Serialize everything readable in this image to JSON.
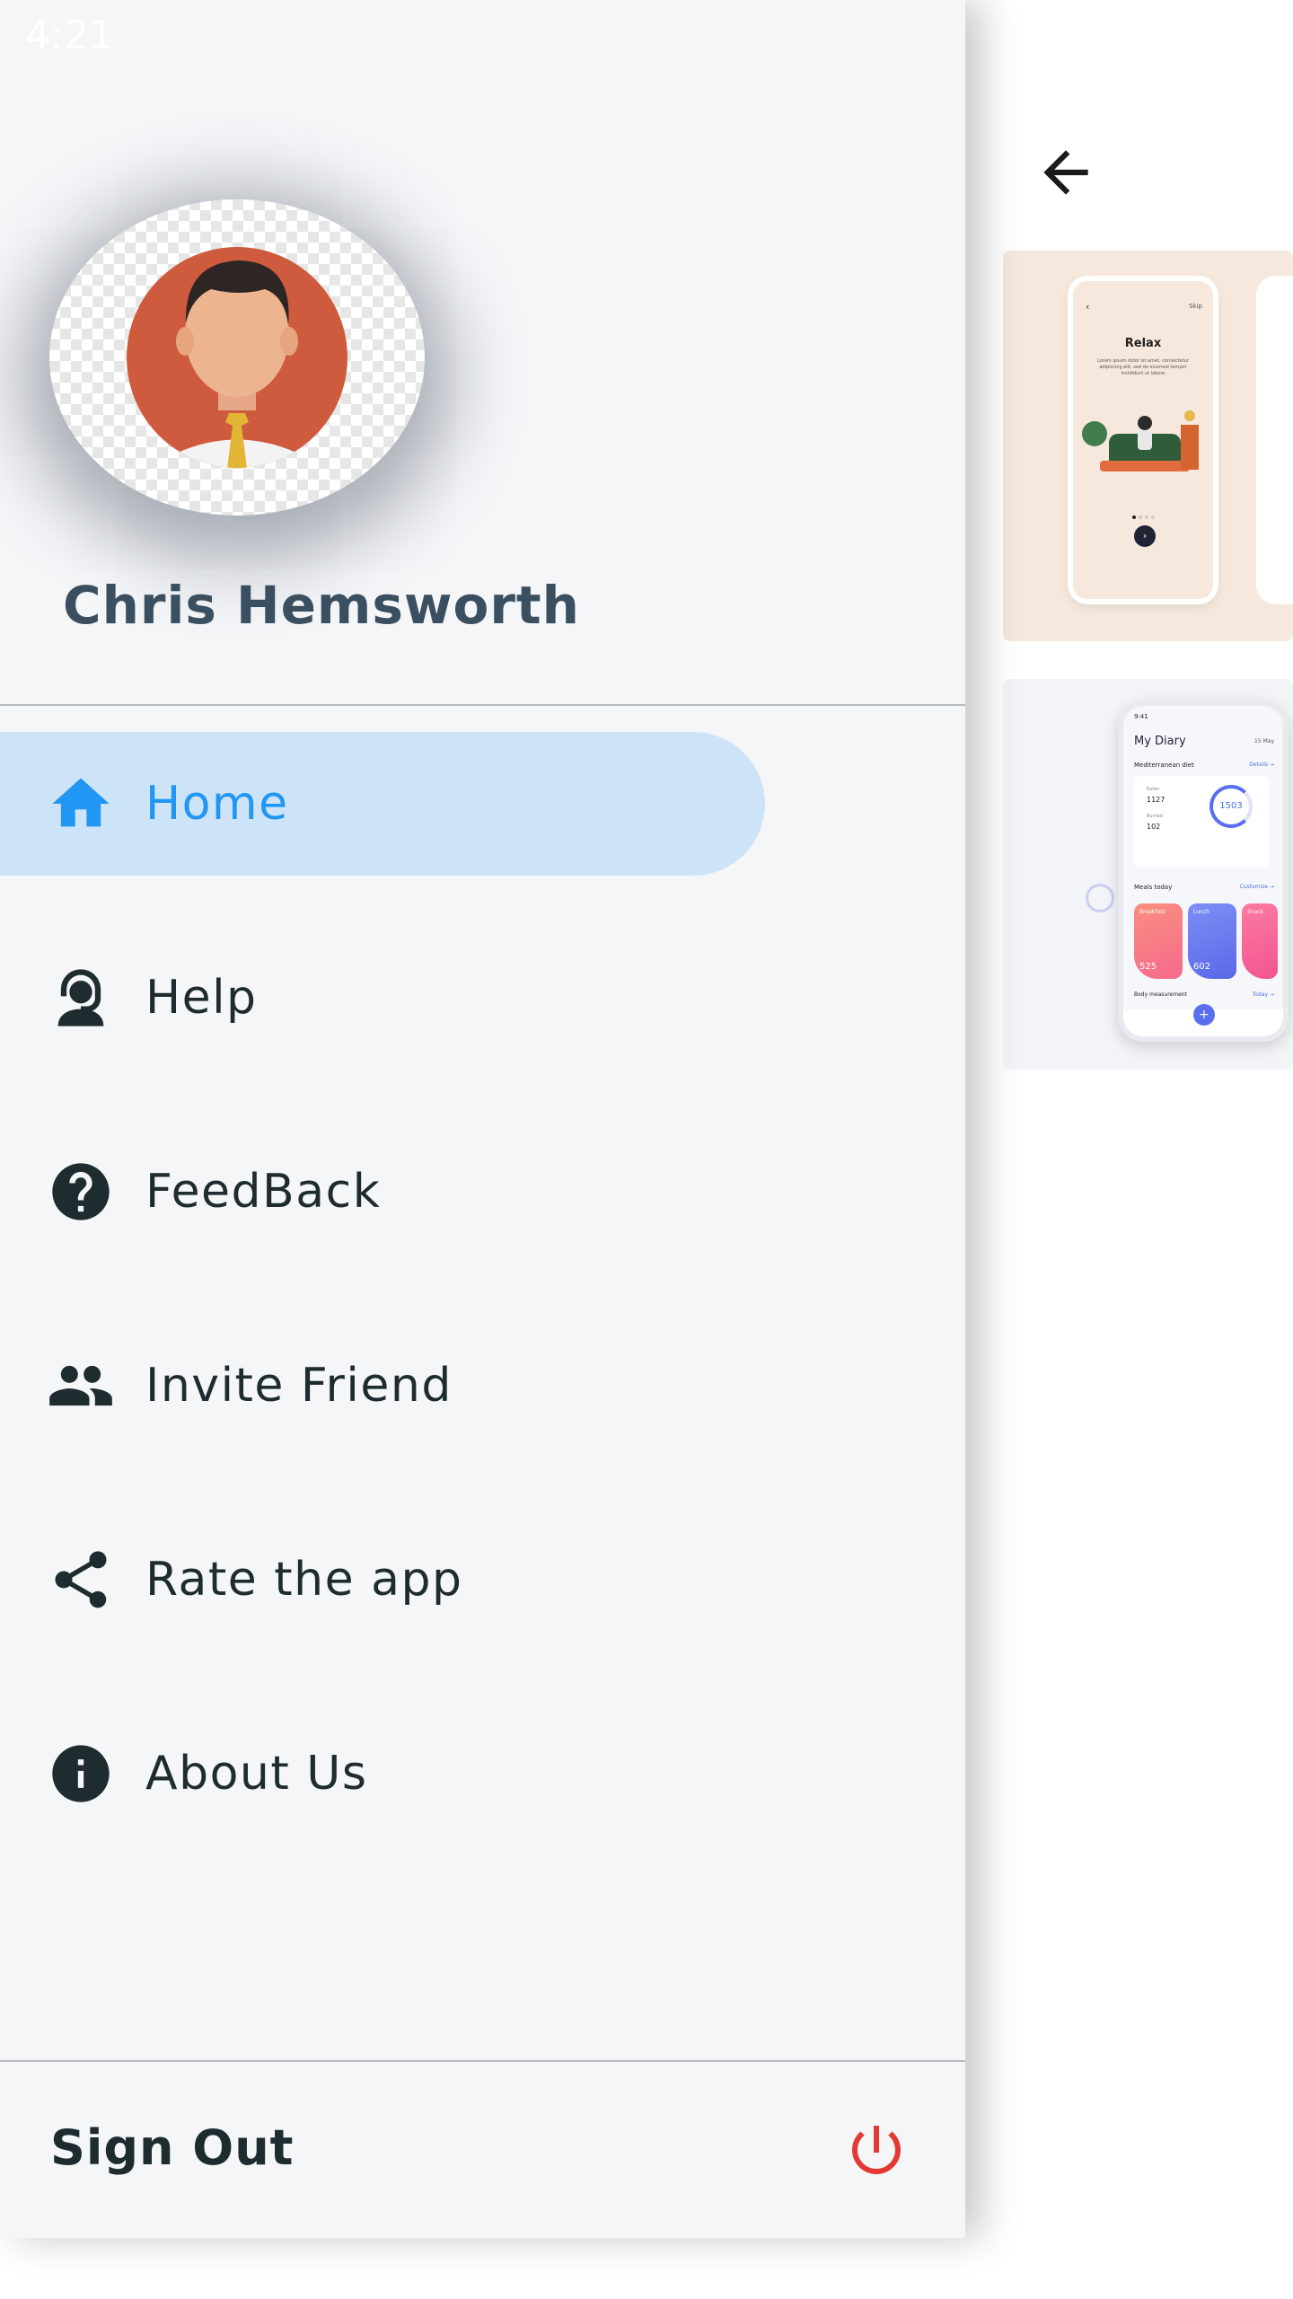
{
  "status_bar": {
    "time": "4:21"
  },
  "drawer": {
    "user_name": "Chris Hemsworth",
    "menu": [
      {
        "label": "Home",
        "icon": "home-icon",
        "active": true
      },
      {
        "label": "Help",
        "icon": "support-agent-icon",
        "active": false
      },
      {
        "label": "FeedBack",
        "icon": "help-circle-icon",
        "active": false
      },
      {
        "label": "Invite Friend",
        "icon": "people-icon",
        "active": false
      },
      {
        "label": "Rate the app",
        "icon": "share-icon",
        "active": false
      },
      {
        "label": "About Us",
        "icon": "info-icon",
        "active": false
      }
    ],
    "sign_out_label": "Sign Out",
    "sign_out_icon": "power-icon",
    "colors": {
      "accent": "#2196f3",
      "active_bg": "#cde3f7",
      "power": "#e53935",
      "text": "#1e2b2f"
    }
  },
  "content": {
    "back_icon": "arrow-back-icon",
    "card_relax": {
      "title": "Relax",
      "skip": "Skip",
      "text": "Lorem ipsum dolor sit amet, consectetur adipiscing elit, sed do eiusmod tempor incididunt ut labore"
    },
    "card_diary": {
      "time": "9:41",
      "title": "My Diary",
      "date": "15 May",
      "section": "Mediterranean diet",
      "details": "Details →",
      "eaten_label": "Eaten",
      "eaten_value": "1127",
      "burned_label": "Burned",
      "burned_value": "102",
      "kcal_left": "1503",
      "meals_title": "Meals today",
      "customize": "Customize →",
      "breakfast": "Breakfast",
      "breakfast_kcal": "525",
      "lunch": "Lunch",
      "lunch_kcal": "602",
      "snack": "Snack",
      "body_measurement": "Body measurement",
      "today": "Today →"
    }
  }
}
